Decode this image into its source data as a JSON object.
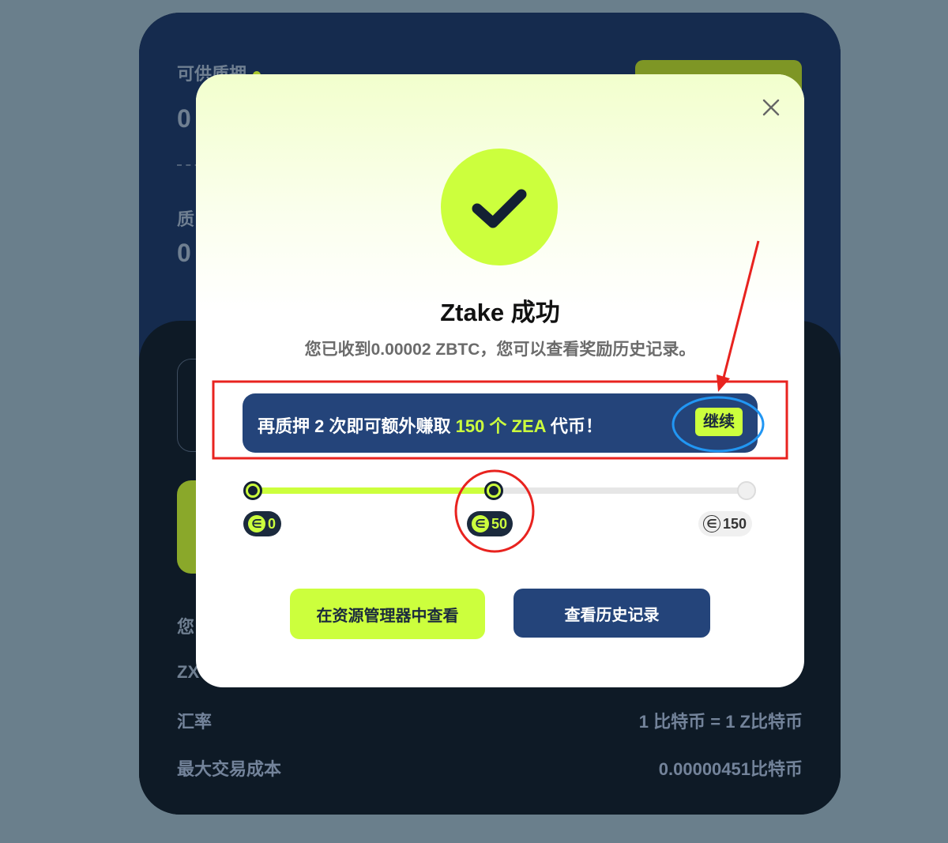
{
  "background": {
    "available_label": "可供质押",
    "available_value": "0",
    "staked_label_partial": "质",
    "staked_value": "0",
    "your_label_partial": "您",
    "zx_label_partial": "ZX",
    "rate_label": "汇率",
    "rate_value": "1 比特币 = 1 Z比特币",
    "max_cost_label": "最大交易成本",
    "max_cost_value": "0.00000451比特币"
  },
  "modal": {
    "close_icon": "close-icon",
    "success_icon": "check-icon",
    "title": "Ztake 成功",
    "subtitle": "您已收到0.00002 ZBTC，您可以查看奖励历史记录。",
    "promo": {
      "text_before": "再质押 2 次即可额外赚取 ",
      "text_highlight": "150 个 ZEA",
      "text_after": " 代币！",
      "continue_label": "继续"
    },
    "progress": {
      "fill_fraction": 0.5,
      "milestones": [
        {
          "label": "0",
          "reached": true
        },
        {
          "label": "50",
          "reached": true
        },
        {
          "label": "150",
          "reached": false
        }
      ],
      "coin_symbol": "∈"
    },
    "buttons": {
      "explorer_label": "在资源管理器中查看",
      "history_label": "查看历史记录"
    }
  },
  "colors": {
    "accent": "#ccff3d",
    "navy": "#24447a",
    "annotation_red": "#e8231f",
    "annotation_blue": "#2196f3"
  }
}
